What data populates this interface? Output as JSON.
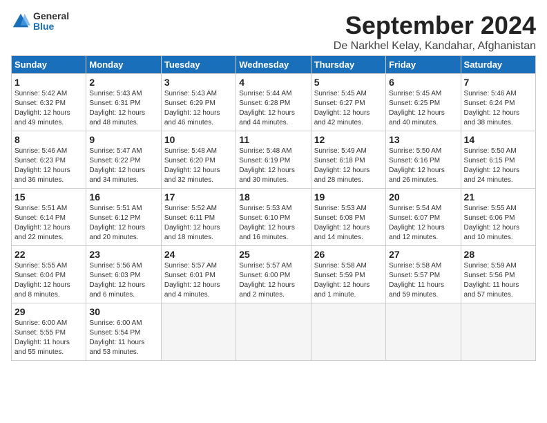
{
  "logo": {
    "general": "General",
    "blue": "Blue"
  },
  "title": "September 2024",
  "location": "De Narkhel Kelay, Kandahar, Afghanistan",
  "days_header": [
    "Sunday",
    "Monday",
    "Tuesday",
    "Wednesday",
    "Thursday",
    "Friday",
    "Saturday"
  ],
  "weeks": [
    [
      {
        "day": "1",
        "text": "Sunrise: 5:42 AM\nSunset: 6:32 PM\nDaylight: 12 hours\nand 49 minutes."
      },
      {
        "day": "2",
        "text": "Sunrise: 5:43 AM\nSunset: 6:31 PM\nDaylight: 12 hours\nand 48 minutes."
      },
      {
        "day": "3",
        "text": "Sunrise: 5:43 AM\nSunset: 6:29 PM\nDaylight: 12 hours\nand 46 minutes."
      },
      {
        "day": "4",
        "text": "Sunrise: 5:44 AM\nSunset: 6:28 PM\nDaylight: 12 hours\nand 44 minutes."
      },
      {
        "day": "5",
        "text": "Sunrise: 5:45 AM\nSunset: 6:27 PM\nDaylight: 12 hours\nand 42 minutes."
      },
      {
        "day": "6",
        "text": "Sunrise: 5:45 AM\nSunset: 6:25 PM\nDaylight: 12 hours\nand 40 minutes."
      },
      {
        "day": "7",
        "text": "Sunrise: 5:46 AM\nSunset: 6:24 PM\nDaylight: 12 hours\nand 38 minutes."
      }
    ],
    [
      {
        "day": "8",
        "text": "Sunrise: 5:46 AM\nSunset: 6:23 PM\nDaylight: 12 hours\nand 36 minutes."
      },
      {
        "day": "9",
        "text": "Sunrise: 5:47 AM\nSunset: 6:22 PM\nDaylight: 12 hours\nand 34 minutes."
      },
      {
        "day": "10",
        "text": "Sunrise: 5:48 AM\nSunset: 6:20 PM\nDaylight: 12 hours\nand 32 minutes."
      },
      {
        "day": "11",
        "text": "Sunrise: 5:48 AM\nSunset: 6:19 PM\nDaylight: 12 hours\nand 30 minutes."
      },
      {
        "day": "12",
        "text": "Sunrise: 5:49 AM\nSunset: 6:18 PM\nDaylight: 12 hours\nand 28 minutes."
      },
      {
        "day": "13",
        "text": "Sunrise: 5:50 AM\nSunset: 6:16 PM\nDaylight: 12 hours\nand 26 minutes."
      },
      {
        "day": "14",
        "text": "Sunrise: 5:50 AM\nSunset: 6:15 PM\nDaylight: 12 hours\nand 24 minutes."
      }
    ],
    [
      {
        "day": "15",
        "text": "Sunrise: 5:51 AM\nSunset: 6:14 PM\nDaylight: 12 hours\nand 22 minutes."
      },
      {
        "day": "16",
        "text": "Sunrise: 5:51 AM\nSunset: 6:12 PM\nDaylight: 12 hours\nand 20 minutes."
      },
      {
        "day": "17",
        "text": "Sunrise: 5:52 AM\nSunset: 6:11 PM\nDaylight: 12 hours\nand 18 minutes."
      },
      {
        "day": "18",
        "text": "Sunrise: 5:53 AM\nSunset: 6:10 PM\nDaylight: 12 hours\nand 16 minutes."
      },
      {
        "day": "19",
        "text": "Sunrise: 5:53 AM\nSunset: 6:08 PM\nDaylight: 12 hours\nand 14 minutes."
      },
      {
        "day": "20",
        "text": "Sunrise: 5:54 AM\nSunset: 6:07 PM\nDaylight: 12 hours\nand 12 minutes."
      },
      {
        "day": "21",
        "text": "Sunrise: 5:55 AM\nSunset: 6:06 PM\nDaylight: 12 hours\nand 10 minutes."
      }
    ],
    [
      {
        "day": "22",
        "text": "Sunrise: 5:55 AM\nSunset: 6:04 PM\nDaylight: 12 hours\nand 8 minutes."
      },
      {
        "day": "23",
        "text": "Sunrise: 5:56 AM\nSunset: 6:03 PM\nDaylight: 12 hours\nand 6 minutes."
      },
      {
        "day": "24",
        "text": "Sunrise: 5:57 AM\nSunset: 6:01 PM\nDaylight: 12 hours\nand 4 minutes."
      },
      {
        "day": "25",
        "text": "Sunrise: 5:57 AM\nSunset: 6:00 PM\nDaylight: 12 hours\nand 2 minutes."
      },
      {
        "day": "26",
        "text": "Sunrise: 5:58 AM\nSunset: 5:59 PM\nDaylight: 12 hours\nand 1 minute."
      },
      {
        "day": "27",
        "text": "Sunrise: 5:58 AM\nSunset: 5:57 PM\nDaylight: 11 hours\nand 59 minutes."
      },
      {
        "day": "28",
        "text": "Sunrise: 5:59 AM\nSunset: 5:56 PM\nDaylight: 11 hours\nand 57 minutes."
      }
    ],
    [
      {
        "day": "29",
        "text": "Sunrise: 6:00 AM\nSunset: 5:55 PM\nDaylight: 11 hours\nand 55 minutes."
      },
      {
        "day": "30",
        "text": "Sunrise: 6:00 AM\nSunset: 5:54 PM\nDaylight: 11 hours\nand 53 minutes."
      },
      {
        "day": "",
        "text": ""
      },
      {
        "day": "",
        "text": ""
      },
      {
        "day": "",
        "text": ""
      },
      {
        "day": "",
        "text": ""
      },
      {
        "day": "",
        "text": ""
      }
    ]
  ]
}
